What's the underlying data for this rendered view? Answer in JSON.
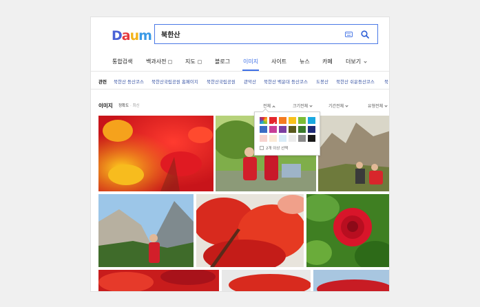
{
  "logo": {
    "letters": [
      "D",
      "a",
      "u",
      "m"
    ],
    "colors": [
      "#4a62d6",
      "#e6383d",
      "#f3b31a",
      "#3b9ae6"
    ]
  },
  "search": {
    "value": "북한산"
  },
  "tabs": [
    "통합검색",
    "백과사전",
    "지도",
    "블로그",
    "이미지",
    "사이트",
    "뉴스",
    "카페",
    "더보기"
  ],
  "active_tab": "이미지",
  "related": {
    "label": "관련",
    "items": [
      "북한산 등산코스",
      "북한산국립공원 홈페이지",
      "북한산국립공원",
      "관악산",
      "북한산 백운대 등산코스",
      "도봉산",
      "북한산 쉬운등산코스",
      "북"
    ]
  },
  "filter": {
    "title": "이미지",
    "sort_selected": "정확도",
    "sort_sep": "·",
    "sort_other": "최신",
    "color": "전체",
    "size": "크기전체",
    "period": "기간전체",
    "type": "유형전체"
  },
  "color_popup": {
    "swatches": [
      "#f55f3a",
      "#e4262c",
      "#f47b20",
      "#f8c11c",
      "#7bbd36",
      "#1ba8e0",
      "#3b6cc4",
      "#c83f96",
      "#7b3fa1",
      "#5a5a1e",
      "#3a7a2e",
      "#1f2b78",
      "#f7d3d0",
      "#fbead6",
      "#d8ecf7",
      "#ececec",
      "#8a8a8a",
      "#1a1a1a"
    ],
    "multi_label": "2개 이상 선택"
  }
}
